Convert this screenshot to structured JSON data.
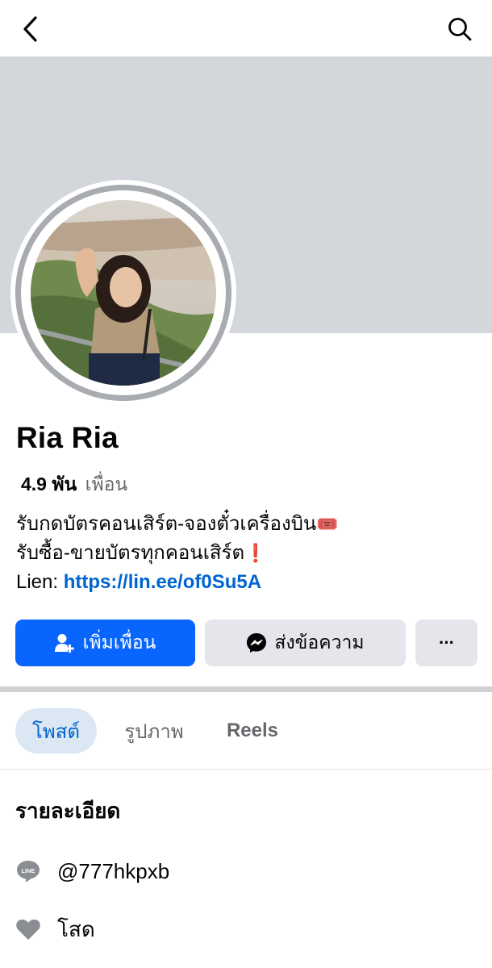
{
  "header": {
    "back_icon": "chevron-left-icon",
    "search_icon": "search-icon"
  },
  "profile": {
    "name": "Ria Ria",
    "friends_count": "4.9 พัน",
    "friends_label": "เพื่อน",
    "bio_line1": "รับกดบัตรคอนเสิร์ต-จองตั๋วเครื่องบิน",
    "bio_line1_emoji": "🎟️",
    "bio_line2": "รับซื้อ-ขายบัตรทุกคอนเสิร์ต",
    "bio_line2_emoji": "❗",
    "bio_line3_prefix": "Lien:",
    "bio_link": "https://lin.ee/of0Su5A"
  },
  "actions": {
    "add_friend_label": "เพิ่มเพื่อน",
    "message_label": "ส่งข้อความ",
    "more_label": "···"
  },
  "tabs": [
    {
      "label": "โพสต์",
      "active": true
    },
    {
      "label": "รูปภาพ",
      "active": false
    },
    {
      "label": "Reels",
      "active": false
    }
  ],
  "details": {
    "title": "รายละเอียด",
    "line_id": "@777hkpxb",
    "line_icon": "line-app-icon",
    "relationship": "โสด",
    "relationship_icon": "heart-icon"
  },
  "colors": {
    "primary": "#0866ff",
    "link": "#0064d1",
    "cover": "#d3d6db",
    "secondary_button": "#e4e6eb"
  }
}
